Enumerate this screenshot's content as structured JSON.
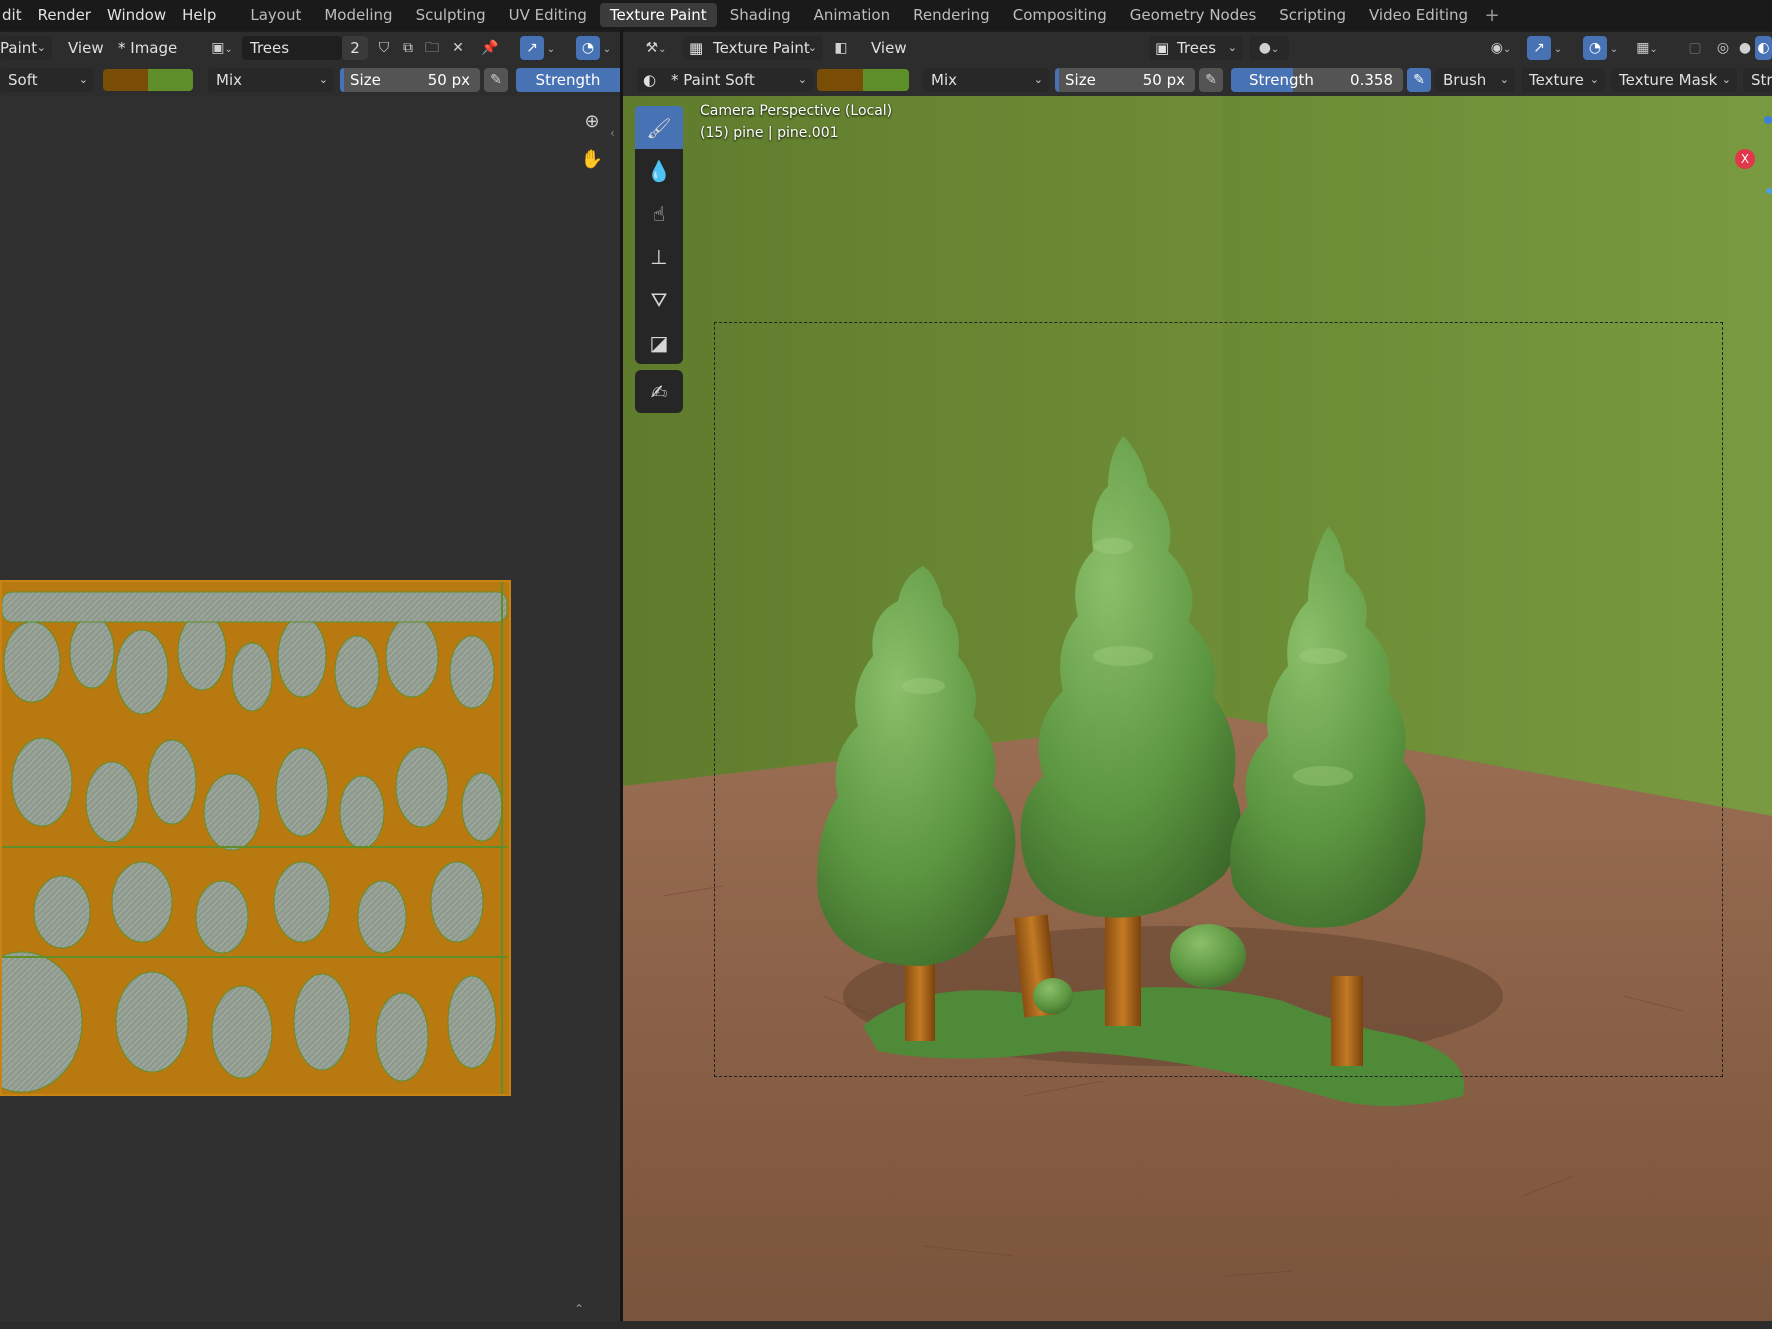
{
  "menus": [
    "dit",
    "Render",
    "Window",
    "Help"
  ],
  "workspaces": [
    "Layout",
    "Modeling",
    "Sculpting",
    "UV Editing",
    "Texture Paint",
    "Shading",
    "Animation",
    "Rendering",
    "Compositing",
    "Geometry Nodes",
    "Scripting",
    "Video Editing"
  ],
  "active_workspace": "Texture Paint",
  "image_editor": {
    "mode": "Paint",
    "view_menu": "View",
    "image_menu": "* Image",
    "image_name": "Trees",
    "users": "2",
    "brush_name": "Soft",
    "blend": "Mix",
    "size_label": "Size",
    "size_value": "50 px",
    "strength_label": "Strength",
    "swatch_colors": [
      "#7a4d05",
      "#5f8f2a"
    ]
  },
  "viewport": {
    "mode": "Texture Paint",
    "view_menu": "View",
    "image_name": "Trees",
    "brush_name": "* Paint Soft",
    "blend": "Mix",
    "size_label": "Size",
    "size_value": "50 px",
    "strength_label": "Strength",
    "strength_value": "0.358",
    "strength_fraction": 0.358,
    "brush_menu": "Brush",
    "texture_menu": "Texture",
    "texture_mask_menu": "Texture Mask",
    "stroke_menu": "Stroke",
    "camera_label": "Camera Perspective (Local)",
    "object_label": "(15) pine | pine.001",
    "gizmo_axis": "X"
  },
  "tools": [
    "draw-tool",
    "soften-tool",
    "smear-tool",
    "clone-tool",
    "fill-tool",
    "mask-tool",
    "annotate-tool"
  ],
  "colors": {
    "accent": "#4772b3",
    "uv_orange": "#b87a10",
    "wall_green": "#6d8a36",
    "floor_brown": "#8a5f43"
  }
}
